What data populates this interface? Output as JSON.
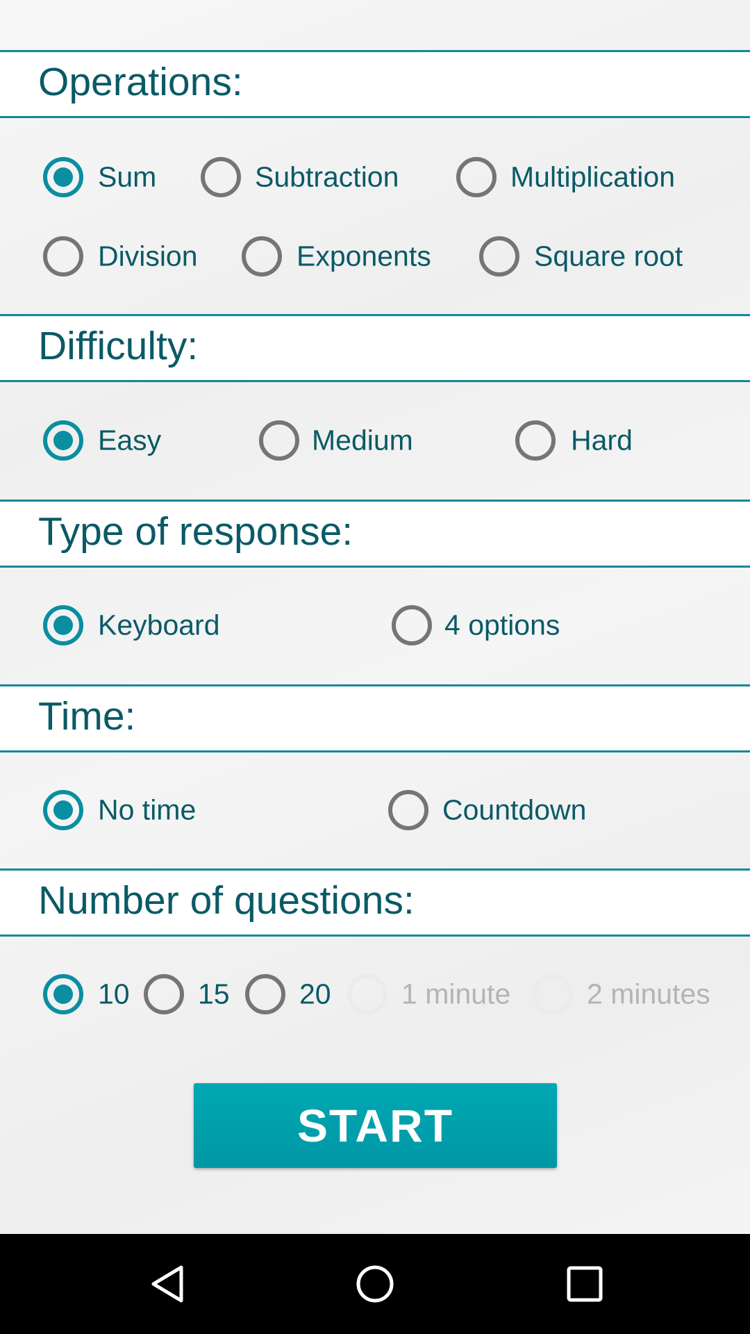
{
  "colors": {
    "accent": "#0a8ea0",
    "header_line": "#12889a",
    "text": "#0a5a66",
    "button": "#00a4b0",
    "unselected": "#757575"
  },
  "operations": {
    "title": "Operations:",
    "options": [
      {
        "label": "Sum",
        "selected": true
      },
      {
        "label": "Subtraction",
        "selected": false
      },
      {
        "label": "Multiplication",
        "selected": false
      },
      {
        "label": "Division",
        "selected": false
      },
      {
        "label": "Exponents",
        "selected": false
      },
      {
        "label": "Square root",
        "selected": false
      }
    ]
  },
  "difficulty": {
    "title": "Difficulty:",
    "options": [
      {
        "label": "Easy",
        "selected": true
      },
      {
        "label": "Medium",
        "selected": false
      },
      {
        "label": "Hard",
        "selected": false
      }
    ]
  },
  "response": {
    "title": "Type of response:",
    "options": [
      {
        "label": "Keyboard",
        "selected": true
      },
      {
        "label": "4 options",
        "selected": false
      }
    ]
  },
  "time": {
    "title": "Time:",
    "options": [
      {
        "label": "No time",
        "selected": true
      },
      {
        "label": "Countdown",
        "selected": false
      }
    ]
  },
  "questions": {
    "title": "Number of questions:",
    "options": [
      {
        "label": "10",
        "selected": true
      },
      {
        "label": "15",
        "selected": false
      },
      {
        "label": "20",
        "selected": false
      },
      {
        "label": "1 minute",
        "selected": false,
        "disabled": true
      },
      {
        "label": "2 minutes",
        "selected": false,
        "disabled": true
      }
    ]
  },
  "start_label": "START",
  "navbar": {
    "icons": [
      "back-icon",
      "home-icon",
      "recents-icon"
    ]
  }
}
